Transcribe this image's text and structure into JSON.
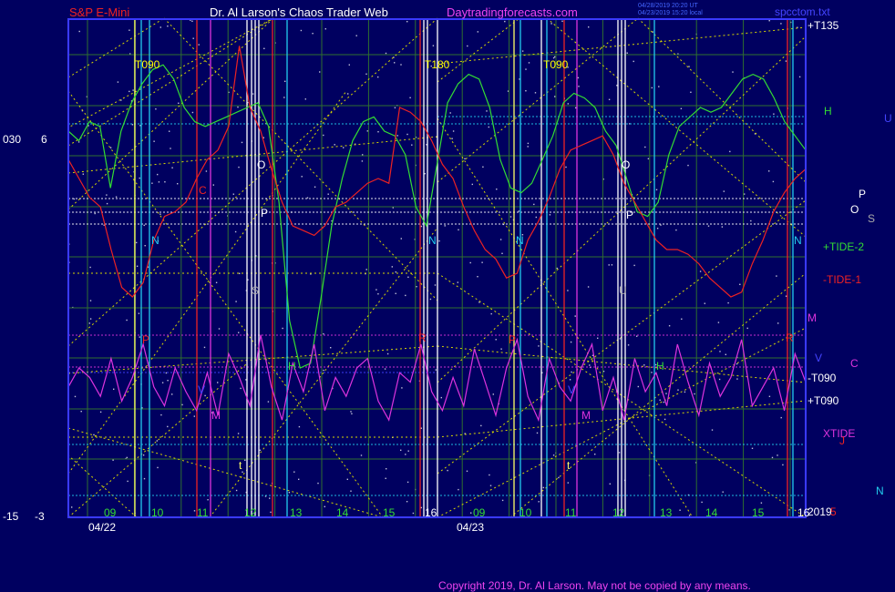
{
  "header": {
    "title_left": "S&P E-Mini",
    "title_center": "Dr. Al Larson's Chaos Trader Web",
    "title_site": "Daytradingforecasts.com",
    "stamp_line1": "04/28/2019 20:20 UT",
    "stamp_line2": "04/23/2019 15:20 local",
    "right_file": "spcctom.txt"
  },
  "footer": {
    "copyright": "Copyright 2019, Dr. Al Larson. May not be copied by any means."
  },
  "colors": {
    "background": "#000060",
    "frame": "#3a3aff",
    "grid": "#2f6f2f",
    "yellow_lines": "#d8d800",
    "green_curve": "#33dd33",
    "red_curve": "#ee2222",
    "magenta_curve": "#dd33dd",
    "cyan": "#22ccee",
    "white": "#ffffff",
    "magenta": "#dd33dd",
    "blue_text": "#4444ff"
  },
  "chart_data": {
    "type": "line",
    "x_tick_labels": [
      "09",
      "10",
      "11",
      "12",
      "13",
      "14",
      "15",
      "16",
      "09",
      "10",
      "11",
      "12",
      "13",
      "14",
      "15",
      "16"
    ],
    "date_labels": [
      "04/22",
      "04/23"
    ],
    "y_tick_labels_left": [
      "030",
      "6",
      "-15",
      "-3"
    ],
    "series": [
      {
        "name": "+TIDE-2",
        "color": "#33dd33",
        "values": [
          60,
          56,
          64,
          62,
          36,
          60,
          72,
          80,
          86,
          88,
          82,
          70,
          64,
          62,
          64,
          66,
          68,
          70,
          72,
          62,
          30,
          -20,
          -40,
          -38,
          -10,
          20,
          40,
          56,
          64,
          66,
          60,
          58,
          50,
          28,
          20,
          46,
          72,
          80,
          84,
          82,
          70,
          48,
          36,
          34,
          38,
          48,
          58,
          72,
          76,
          74,
          70,
          60,
          54,
          40,
          26,
          24,
          30,
          50,
          62,
          66,
          70,
          68,
          70,
          76,
          82,
          84,
          82,
          74,
          64,
          58,
          52
        ]
      },
      {
        "name": "-TIDE-1",
        "color": "#ee2222",
        "values": [
          48,
          40,
          32,
          28,
          10,
          -6,
          -10,
          -4,
          14,
          24,
          26,
          30,
          40,
          48,
          52,
          62,
          96,
          70,
          60,
          44,
          30,
          20,
          18,
          16,
          20,
          28,
          30,
          34,
          38,
          40,
          38,
          70,
          68,
          64,
          56,
          46,
          40,
          28,
          18,
          10,
          6,
          -2,
          0,
          14,
          22,
          32,
          44,
          52,
          54,
          56,
          58,
          50,
          38,
          30,
          22,
          14,
          10,
          10,
          8,
          4,
          -2,
          -6,
          -10,
          -8,
          4,
          14,
          26,
          34,
          40,
          44
        ]
      },
      {
        "name": "XTIDE",
        "color": "#dd33dd",
        "values": [
          -48,
          -40,
          -44,
          -52,
          -36,
          -54,
          -44,
          -30,
          -48,
          -56,
          -40,
          -50,
          -58,
          -42,
          -60,
          -34,
          -44,
          -56,
          -26,
          -48,
          -62,
          -38,
          -50,
          -30,
          -58,
          -44,
          -52,
          -40,
          -36,
          -54,
          -62,
          -42,
          -46,
          -30,
          -50,
          -58,
          -44,
          -56,
          -32,
          -46,
          -60,
          -40,
          -28,
          -52,
          -62,
          -36,
          -48,
          -54,
          -40,
          -30,
          -58,
          -44,
          -62,
          -36,
          -50,
          -42,
          -56,
          -30,
          -46,
          -60,
          -38,
          -52,
          -44,
          -28,
          -56,
          -48,
          -40,
          -58,
          -34,
          -46
        ]
      }
    ],
    "right_labels": [
      {
        "text": "+T135",
        "color": "#ffffff"
      },
      {
        "text": "H",
        "color": "#33dd33"
      },
      {
        "text": "U",
        "color": "#4444ff"
      },
      {
        "text": "P",
        "color": "#ffffff"
      },
      {
        "text": "O",
        "color": "#ffffff"
      },
      {
        "text": "S",
        "color": "#aaaaaa"
      },
      {
        "text": "+TIDE-2",
        "color": "#33dd33"
      },
      {
        "text": "-TIDE-1",
        "color": "#ee2222"
      },
      {
        "text": "M",
        "color": "#dd33dd"
      },
      {
        "text": "V",
        "color": "#4444ff"
      },
      {
        "text": "C",
        "color": "#dd33dd"
      },
      {
        "text": "-T090",
        "color": "#ffffff"
      },
      {
        "text": "+T090",
        "color": "#ffffff"
      },
      {
        "text": "XTIDE",
        "color": "#dd33dd"
      },
      {
        "text": "J",
        "color": "#ee2222"
      },
      {
        "text": "N",
        "color": "#22ccee"
      },
      {
        "text": "2019",
        "color": "#ffffff"
      },
      {
        "text": "5",
        "color": "#ee2222"
      }
    ],
    "markers": [
      {
        "text": "T090",
        "color": "#ffff00"
      },
      {
        "text": "T180",
        "color": "#ffff00"
      },
      {
        "text": "T090",
        "color": "#ffff00"
      },
      {
        "text": "N",
        "color": "#22ccee"
      },
      {
        "text": "N",
        "color": "#22ccee"
      },
      {
        "text": "N",
        "color": "#22ccee"
      },
      {
        "text": "N",
        "color": "#22ccee"
      },
      {
        "text": "C",
        "color": "#ee2222"
      },
      {
        "text": "O",
        "color": "#ffffff"
      },
      {
        "text": "O",
        "color": "#ffffff"
      },
      {
        "text": "P",
        "color": "#ffffff"
      },
      {
        "text": "P",
        "color": "#ffffff"
      },
      {
        "text": "S",
        "color": "#aaaaaa"
      },
      {
        "text": "U",
        "color": "#aaaaaa"
      },
      {
        "text": "H",
        "color": "#33dd33"
      },
      {
        "text": "H",
        "color": "#33dd33"
      },
      {
        "text": "M",
        "color": "#dd33dd"
      },
      {
        "text": "M",
        "color": "#dd33dd"
      },
      {
        "text": "V",
        "color": "#4444ff"
      },
      {
        "text": "V",
        "color": "#4444ff"
      },
      {
        "text": "P",
        "color": "#ee2222"
      },
      {
        "text": "P",
        "color": "#ee2222"
      },
      {
        "text": "t",
        "color": "#ffff66"
      },
      {
        "text": "t",
        "color": "#ffff66"
      },
      {
        "text": "R",
        "color": "#ee2222"
      },
      {
        "text": "R",
        "color": "#ee2222"
      }
    ]
  }
}
